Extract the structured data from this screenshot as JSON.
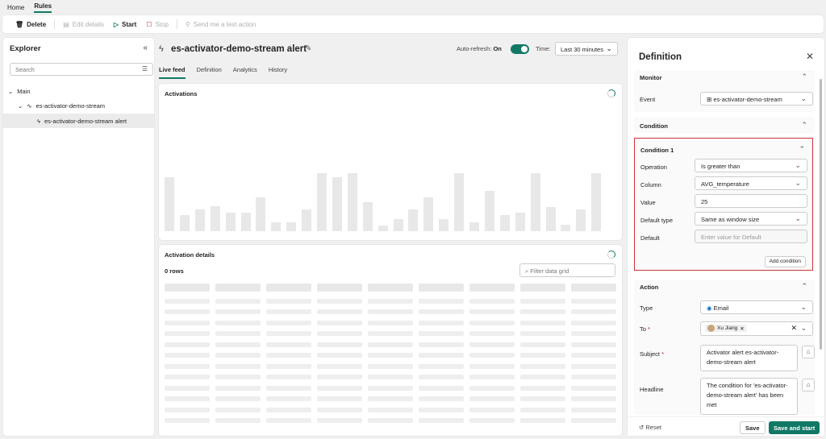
{
  "top_tabs": [
    {
      "label": "Home"
    },
    {
      "label": "Rules"
    }
  ],
  "ribbon": {
    "delete": "Delete",
    "edit_details": "Edit details",
    "start": "Start",
    "stop": "Stop",
    "send_test": "Send me a test action"
  },
  "explorer": {
    "title": "Explorer",
    "search_placeholder": "Search",
    "tree": [
      {
        "label": "Main"
      },
      {
        "label": "es-activator-demo-stream"
      },
      {
        "label": "es-activator-demo-stream alert"
      }
    ]
  },
  "center": {
    "title": "es-activator-demo-stream alert",
    "auto_refresh_label": "Auto-refresh:",
    "auto_refresh_value": "On",
    "time_label": "Time:",
    "time_value": "Last 30 minutes",
    "tabs": [
      {
        "label": "Live feed"
      },
      {
        "label": "Definition"
      },
      {
        "label": "Analytics"
      },
      {
        "label": "History"
      }
    ],
    "activations_title": "Activations",
    "details_title": "Activation details",
    "rows_label": "0 rows",
    "filter_placeholder": "Filter data grid"
  },
  "definition": {
    "title": "Definition",
    "monitor": {
      "title": "Monitor",
      "event_label": "Event",
      "event_value": "es-activator-demo-stream"
    },
    "condition": {
      "title": "Condition"
    },
    "condition1": {
      "title": "Condition 1",
      "operation_label": "Operation",
      "operation_value": "Is greater than",
      "column_label": "Column",
      "column_value": "AVG_temperature",
      "value_label": "Value",
      "value_value": "25",
      "default_type_label": "Default type",
      "default_type_value": "Same as window size",
      "default_label": "Default",
      "default_placeholder": "Enter value for Default",
      "add_condition": "Add condition"
    },
    "action": {
      "title": "Action",
      "type_label": "Type",
      "type_value": "Email",
      "to_label": "To",
      "to_value": "Xu Jiang",
      "subject_label": "Subject",
      "subject_value": "Activator alert es-activator-demo-stream alert",
      "headline_label": "Headline",
      "headline_value": "The condition for 'es-activator-demo-stream alert' has been met"
    },
    "footer": {
      "reset": "Reset",
      "save": "Save",
      "save_and_start": "Save and start"
    }
  },
  "colors": {
    "accent": "#117865",
    "highlight_border": "#d13438"
  }
}
